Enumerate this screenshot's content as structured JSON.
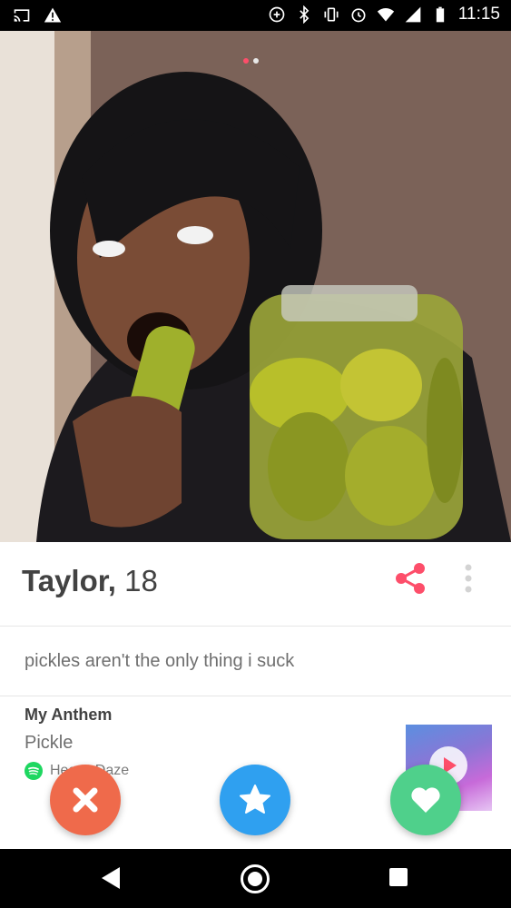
{
  "status_bar": {
    "time": "11:15",
    "icons": [
      "cast-icon",
      "warning-icon",
      "data-saver-icon",
      "bluetooth-icon",
      "vibrate-icon",
      "alarm-icon",
      "wifi-icon",
      "signal-icon",
      "battery-icon"
    ]
  },
  "profile": {
    "name": "Taylor",
    "age": "18",
    "photo_count": 2,
    "active_photo": 1,
    "bio": "pickles aren't the only thing i suck"
  },
  "anthem": {
    "heading": "My Anthem",
    "song": "Pickle",
    "artist": "Heavy Daze"
  },
  "actions": [
    "nope-button",
    "super-like-button",
    "like-button"
  ],
  "colors": {
    "accent": "#fd4e6a",
    "nope": "#ef6a4b",
    "super_like": "#2fa0f0",
    "like": "#4fd08b",
    "spotify": "#1ed760"
  }
}
